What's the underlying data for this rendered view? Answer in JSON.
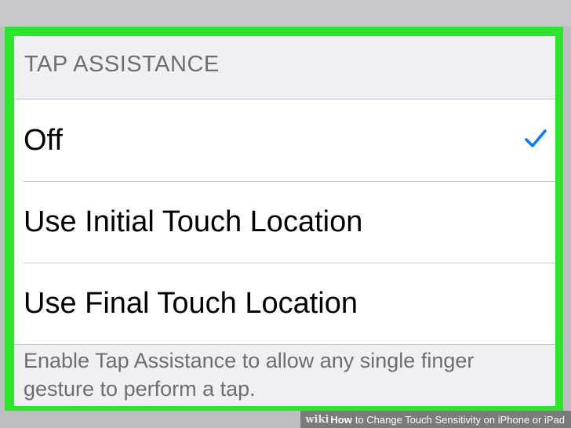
{
  "section": {
    "header": "TAP ASSISTANCE",
    "options": [
      {
        "label": "Off",
        "selected": true
      },
      {
        "label": "Use Initial Touch Location",
        "selected": false
      },
      {
        "label": "Use Final Touch Location",
        "selected": false
      }
    ],
    "footer": "Enable Tap Assistance to allow any single finger gesture to perform a tap."
  },
  "caption": {
    "brand": "wiki",
    "how": "How",
    "text": "to Change Touch Sensitivity on iPhone or iPad"
  },
  "colors": {
    "highlight_border": "#2ee52e",
    "check_accent": "#007aff"
  },
  "icons": {
    "checkmark": "checkmark-icon"
  }
}
